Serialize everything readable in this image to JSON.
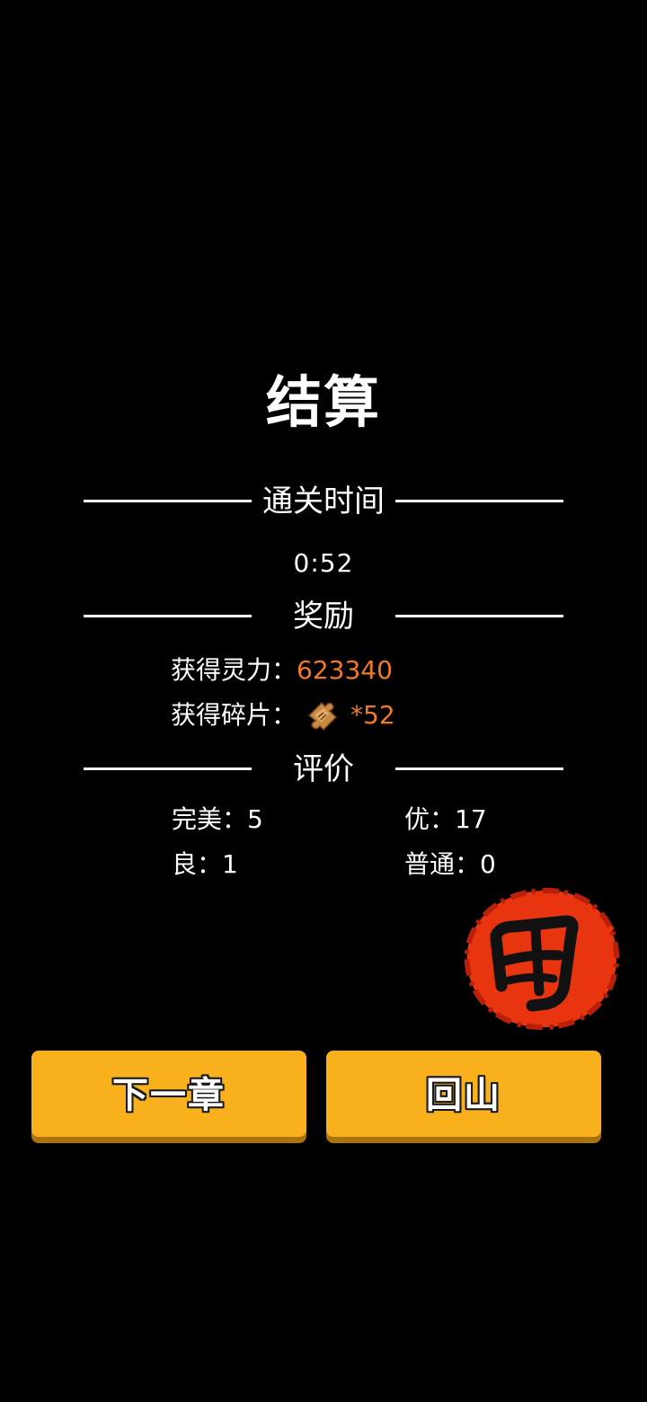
{
  "title": "结算",
  "sections": {
    "clear_time": {
      "label": "通关时间",
      "value": "0:52"
    },
    "rewards": {
      "label": "奖励",
      "spirit_label": "获得灵力：",
      "spirit_value": "623340",
      "fragment_label": "获得碎片：",
      "fragment_icon": "puzzle-fragment-icon",
      "fragment_value": "*52"
    },
    "rating": {
      "label": "评价",
      "perfect": "完美：5",
      "excellent": "优：17",
      "good": "良：1",
      "normal": "普通：0",
      "grade_stamp_icon": "red-grade-seal-icon"
    }
  },
  "buttons": {
    "next_chapter": "下一章",
    "return_mountain": "回山"
  },
  "colors": {
    "background": "#000000",
    "text": "#ffffff",
    "highlight": "#f07a28",
    "button": "#f8b11d",
    "stamp": "#e8340f"
  }
}
